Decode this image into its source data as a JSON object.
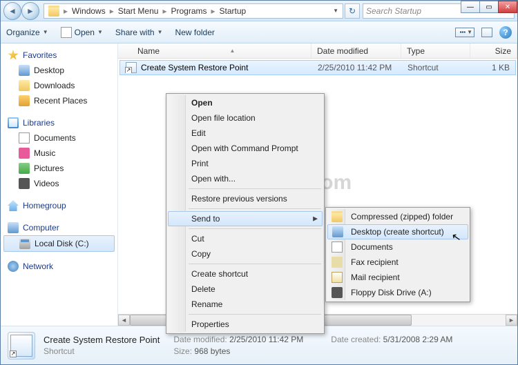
{
  "titlebar": {
    "breadcrumb": [
      "Windows",
      "Start Menu",
      "Programs",
      "Startup"
    ],
    "search_placeholder": "Search Startup"
  },
  "toolbar": {
    "organize": "Organize",
    "open": "Open",
    "share": "Share with",
    "newfolder": "New folder"
  },
  "sidebar": {
    "favorites": {
      "label": "Favorites",
      "items": [
        "Desktop",
        "Downloads",
        "Recent Places"
      ]
    },
    "libraries": {
      "label": "Libraries",
      "items": [
        "Documents",
        "Music",
        "Pictures",
        "Videos"
      ]
    },
    "homegroup": {
      "label": "Homegroup"
    },
    "computer": {
      "label": "Computer",
      "items": [
        "Local Disk (C:)"
      ]
    },
    "network": {
      "label": "Network"
    }
  },
  "columns": {
    "name": "Name",
    "date": "Date modified",
    "type": "Type",
    "size": "Size"
  },
  "files": [
    {
      "name": "Create System Restore Point",
      "date": "2/25/2010 11:42 PM",
      "type": "Shortcut",
      "size": "1 KB"
    }
  ],
  "details": {
    "name": "Create System Restore Point",
    "typeline": "Shortcut",
    "date_modified_label": "Date modified:",
    "date_modified": "2/25/2010 11:42 PM",
    "size_label": "Size:",
    "size": "968 bytes",
    "date_created_label": "Date created:",
    "date_created": "5/31/2008 2:29 AM"
  },
  "context_menu": {
    "open": "Open",
    "open_file_location": "Open file location",
    "edit": "Edit",
    "open_cmd": "Open with Command Prompt",
    "print": "Print",
    "open_with": "Open with...",
    "restore": "Restore previous versions",
    "send_to": "Send to",
    "cut": "Cut",
    "copy": "Copy",
    "create_shortcut": "Create shortcut",
    "delete": "Delete",
    "rename": "Rename",
    "properties": "Properties"
  },
  "send_to_menu": {
    "compressed": "Compressed (zipped) folder",
    "desktop": "Desktop (create shortcut)",
    "documents": "Documents",
    "fax": "Fax recipient",
    "mail": "Mail recipient",
    "floppy": "Floppy Disk Drive (A:)"
  },
  "watermark": "SevenForums.com"
}
